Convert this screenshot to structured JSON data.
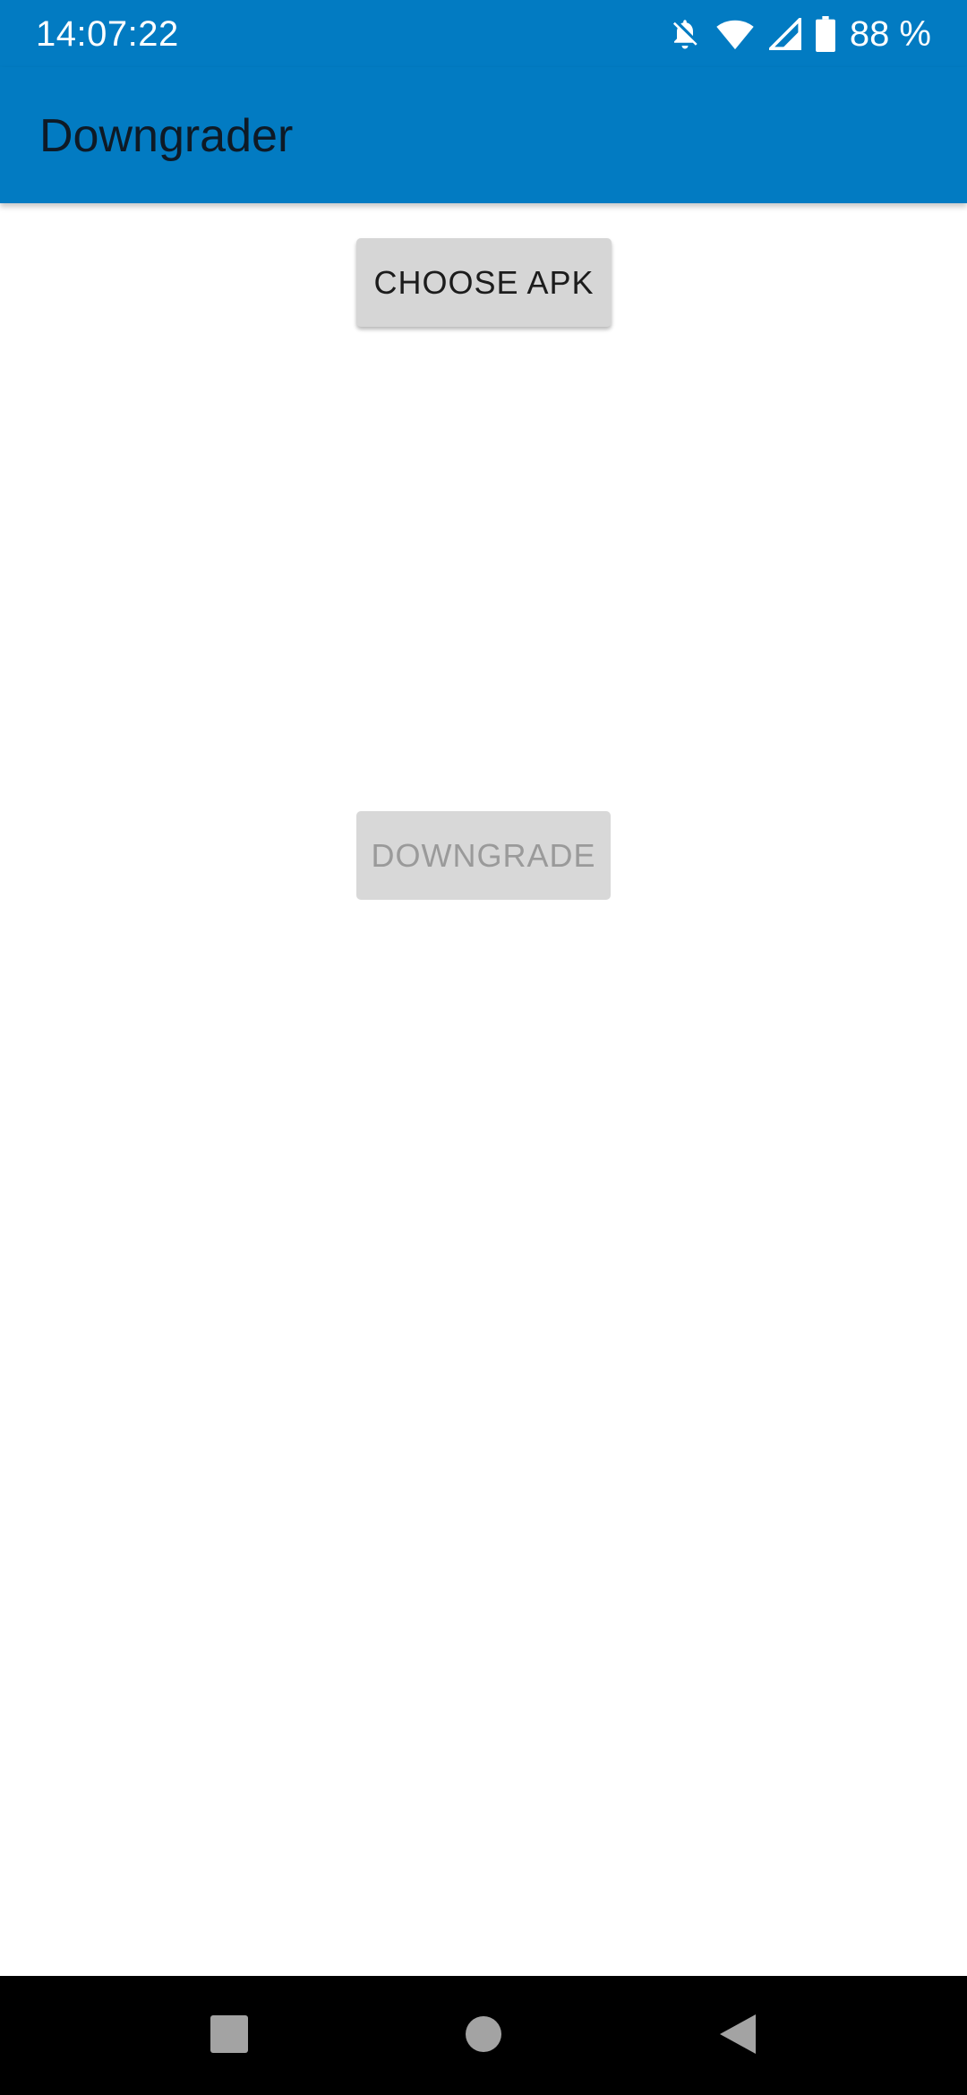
{
  "status_bar": {
    "time": "14:07:22",
    "battery_percent": "88 %",
    "icons": [
      "notifications-off-icon",
      "wifi-icon",
      "cellular-signal-icon",
      "battery-icon"
    ]
  },
  "app_bar": {
    "title": "Downgrader",
    "color": "#027bc2"
  },
  "main": {
    "choose_apk_label": "CHOOSE APK",
    "downgrade_label": "DOWNGRADE",
    "downgrade_enabled": false
  },
  "nav_bar": {
    "icons": [
      "recents-icon",
      "home-icon",
      "back-icon"
    ]
  }
}
